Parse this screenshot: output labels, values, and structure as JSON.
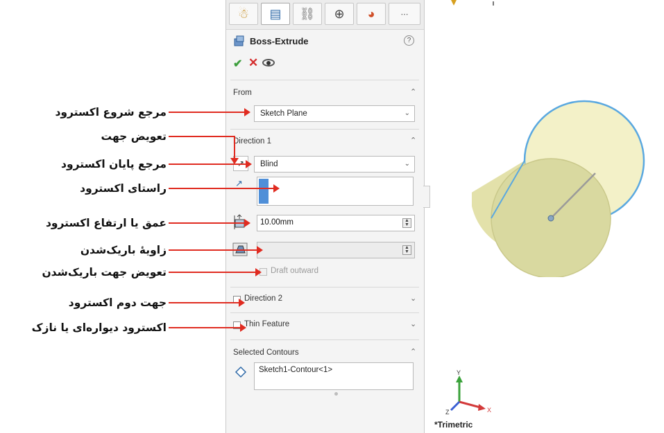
{
  "panel": {
    "tabs": [
      "feature-manager-tab",
      "property-manager-tab",
      "configuration-manager-tab",
      "dimxpert-manager-tab",
      "display-manager-tab",
      "more-tab"
    ],
    "title": "Boss-Extrude",
    "help": "?",
    "from": {
      "header": "From",
      "value": "Sketch Plane"
    },
    "direction1": {
      "header": "Direction 1",
      "end_condition": "Blind",
      "depth": "10.00mm",
      "draft_angle": "",
      "draft_outward": "Draft outward"
    },
    "direction2": {
      "header": "Direction 2"
    },
    "thin_feature": {
      "header": "Thin Feature"
    },
    "selected_contours": {
      "header": "Selected Contours",
      "item": "Sketch1-Contour<1>"
    }
  },
  "callouts": [
    "مرجع شروع اکسترود",
    "تعویض جهت",
    "مرجع پایان اکسترود",
    "راستای اکسترود",
    "عمق یا ارتفاع اکسترود",
    "زاویهٔ باریک‌شدن",
    "تعویض جهت باریک‌شدن",
    "جهت دوم اکسترود",
    "اکسترود دیواره‌ای یا نازک"
  ],
  "viewport": {
    "view_name": "*Trimetric",
    "triad": {
      "x": "X",
      "y": "Y",
      "z": "Z"
    }
  },
  "colors": {
    "callout_arrow": "#e02b20",
    "cylinder_face": "#d9d9a0",
    "cylinder_edge": "#5aa8e0",
    "check_green": "#3d9e3d",
    "cancel_red": "#d42c2c"
  }
}
